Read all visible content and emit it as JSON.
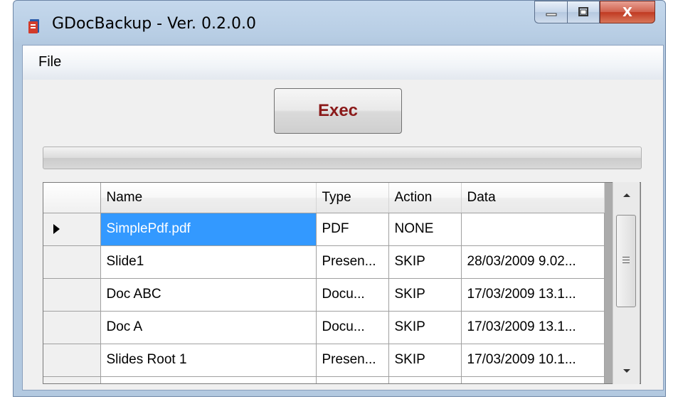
{
  "window": {
    "title": "GDocBackup - Ver. 0.2.0.0",
    "icon": "gdoc-app-icon",
    "controls": {
      "minimize": "minimize-icon",
      "maximize": "maximize-icon",
      "close_label": "X"
    }
  },
  "menu": {
    "items": [
      {
        "label": "File"
      }
    ]
  },
  "toolbar": {
    "exec_label": "Exec",
    "exec_color": "#8b1a1a"
  },
  "progress": {
    "value": 0
  },
  "grid": {
    "columns": [
      {
        "label": "Name"
      },
      {
        "label": "Type"
      },
      {
        "label": "Action"
      },
      {
        "label": "Data"
      }
    ],
    "rows": [
      {
        "name": "SimplePdf.pdf",
        "type": "PDF",
        "action": "NONE",
        "data": "",
        "current": true,
        "selected": true
      },
      {
        "name": "Slide1",
        "type": "Presen...",
        "action": "SKIP",
        "data": "28/03/2009 9.02..."
      },
      {
        "name": "Doc ABC",
        "type": "Docu...",
        "action": "SKIP",
        "data": "17/03/2009 13.1..."
      },
      {
        "name": "Doc A",
        "type": "Docu...",
        "action": "SKIP",
        "data": "17/03/2009 13.1..."
      },
      {
        "name": "Slides Root 1",
        "type": "Presen...",
        "action": "SKIP",
        "data": "17/03/2009 10.1..."
      },
      {
        "name": "",
        "type": "",
        "action": "",
        "data": ""
      }
    ],
    "selection_color": "#3399ff"
  },
  "scrollbar": {
    "up": "scroll-up-arrow-icon",
    "down": "scroll-down-arrow-icon"
  }
}
